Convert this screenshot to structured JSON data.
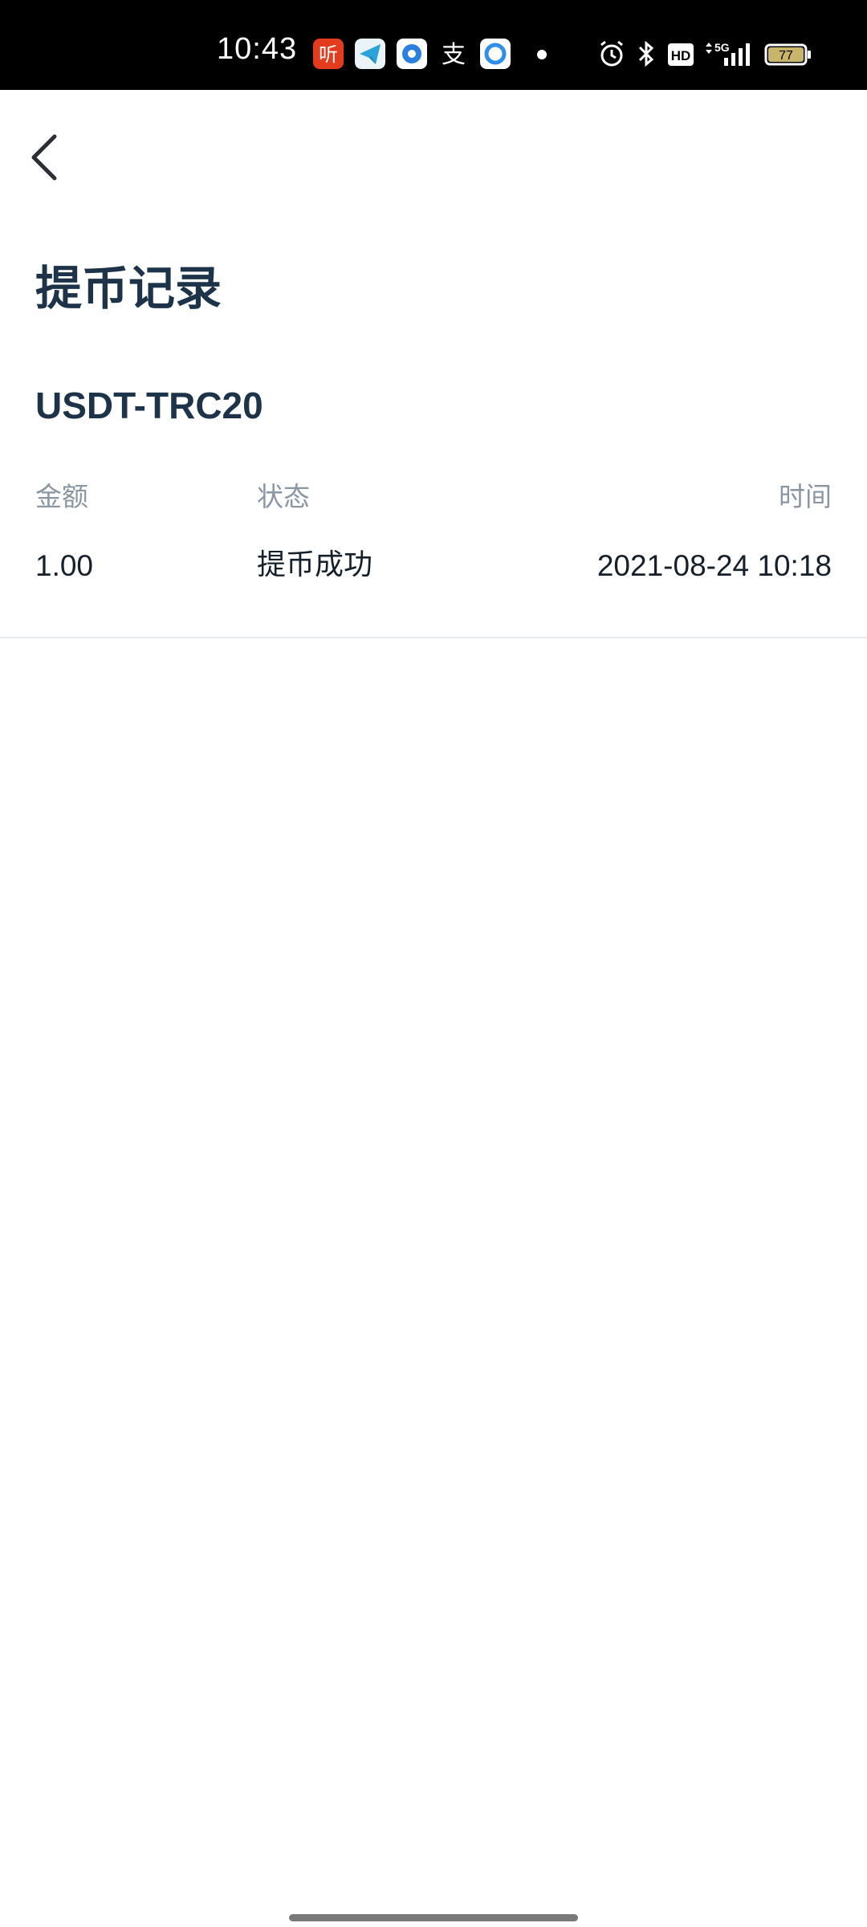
{
  "status_bar": {
    "time": "10:43",
    "app_icons": [
      "listen-app-icon",
      "paper-plane-app-icon",
      "browser-app-icon",
      "alipay-app-icon",
      "cloud-app-icon"
    ],
    "network_label": "5G",
    "hd_label": "HD",
    "battery_level": "77"
  },
  "header": {
    "title": "提币记录",
    "back_icon": "chevron-left-icon"
  },
  "coin": {
    "name": "USDT-TRC20"
  },
  "table": {
    "headers": {
      "amount": "金额",
      "status": "状态",
      "time": "时间"
    },
    "rows": [
      {
        "amount": "1.00",
        "status": "提币成功",
        "time": "2021-08-24 10:18"
      }
    ]
  },
  "colors": {
    "title": "#1c3349",
    "header_text": "#8a96a3",
    "row_text": "#16202b",
    "divider": "#e8ebef"
  }
}
